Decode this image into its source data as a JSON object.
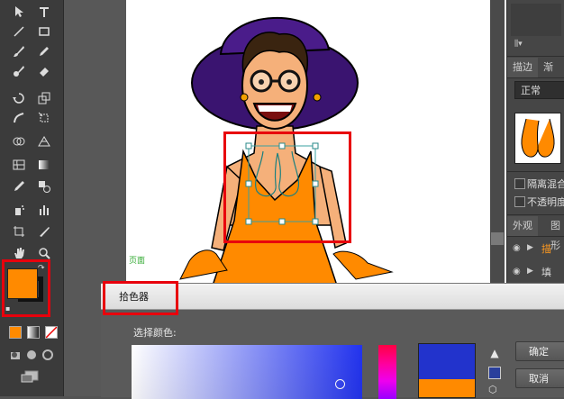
{
  "toolbar": {
    "tools": [
      "selection-tool",
      "direct-selection-tool",
      "pen-tool",
      "type-tool",
      "line-tool",
      "rectangle-tool",
      "paintbrush-tool",
      "pencil-tool",
      "blob-brush-tool",
      "eraser-tool",
      "rotate-tool",
      "scale-tool",
      "warp-tool",
      "free-transform-tool",
      "shape-builder-tool",
      "perspective-grid-tool",
      "mesh-tool",
      "gradient-tool",
      "eyedropper-tool",
      "blend-tool",
      "symbol-sprayer-tool",
      "column-graph-tool",
      "artboard-tool",
      "slice-tool",
      "hand-tool",
      "zoom-tool"
    ],
    "fill_color": "#ff8a00",
    "stroke_color": "#111111"
  },
  "canvas": {
    "page_label": "页面"
  },
  "panel": {
    "tab_stroke": "描边",
    "tab_gradient": "渐变",
    "blend_mode": "正常",
    "check_isolate": "隔离混合",
    "check_knockout": "不透明度",
    "tab_appearance": "外观",
    "tab_graphic": "图形",
    "row1_label": "描",
    "row2_label": "填"
  },
  "picker": {
    "title": "拾色器",
    "select_color_label": "选择颜色:",
    "ok_button": "确定",
    "cancel_button": "取消",
    "new_color": "#2233cc",
    "old_color": "#ff8a00"
  },
  "annotation_color": "#e8000c"
}
